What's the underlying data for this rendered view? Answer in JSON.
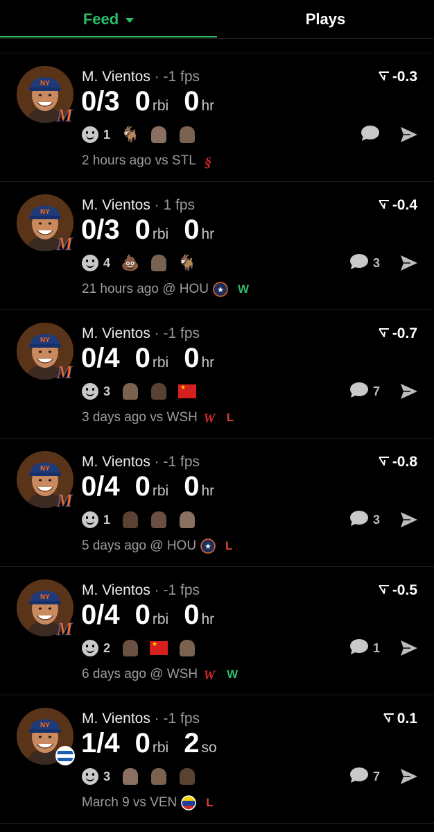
{
  "tabs": [
    {
      "label": "Feed",
      "active": true
    },
    {
      "label": "Plays",
      "active": false
    }
  ],
  "colors": {
    "accent": "#2dbc6a",
    "win": "#2dbc6a",
    "loss": "#e0403a",
    "background": "#000000"
  },
  "feed": [
    {
      "player": "M. Vientos",
      "fps": "-1 fps",
      "score_icon": "volatility-icon",
      "score": "-0.3",
      "hits": "0/3",
      "stat2_value": "0",
      "stat2_unit": "rbi",
      "stat3_value": "0",
      "stat3_unit": "hr",
      "smile_count": "1",
      "reactions": [
        "goat-emoji",
        "face-emoji",
        "face-emoji"
      ],
      "comment_count": "",
      "time": "2 hours ago",
      "venue": "vs STL",
      "opponent_icon": "cardinals-logo-icon",
      "result": "",
      "badge": "mets-logo-icon"
    },
    {
      "player": "M. Vientos",
      "fps": "1 fps",
      "score_icon": "volatility-icon",
      "score": "-0.4",
      "hits": "0/3",
      "stat2_value": "0",
      "stat2_unit": "rbi",
      "stat3_value": "0",
      "stat3_unit": "hr",
      "smile_count": "4",
      "reactions": [
        "poop-emoji",
        "face-emoji",
        "goat-emoji"
      ],
      "comment_count": "3",
      "time": "21 hours ago",
      "venue": "@ HOU",
      "opponent_icon": "astros-logo-icon",
      "result": "W",
      "badge": "mets-logo-icon"
    },
    {
      "player": "M. Vientos",
      "fps": "-1 fps",
      "score_icon": "volatility-icon",
      "score": "-0.7",
      "hits": "0/4",
      "stat2_value": "0",
      "stat2_unit": "rbi",
      "stat3_value": "0",
      "stat3_unit": "hr",
      "smile_count": "3",
      "reactions": [
        "face-emoji",
        "face-emoji",
        "china-flag-emoji"
      ],
      "comment_count": "7",
      "time": "3 days ago",
      "venue": "vs WSH",
      "opponent_icon": "nationals-logo-icon",
      "result": "L",
      "badge": "mets-logo-icon"
    },
    {
      "player": "M. Vientos",
      "fps": "-1 fps",
      "score_icon": "volatility-icon",
      "score": "-0.8",
      "hits": "0/4",
      "stat2_value": "0",
      "stat2_unit": "rbi",
      "stat3_value": "0",
      "stat3_unit": "hr",
      "smile_count": "1",
      "reactions": [
        "face-emoji",
        "face-emoji",
        "face-emoji"
      ],
      "comment_count": "3",
      "time": "5 days ago",
      "venue": "@ HOU",
      "opponent_icon": "astros-logo-icon",
      "result": "L",
      "badge": "mets-logo-icon"
    },
    {
      "player": "M. Vientos",
      "fps": "-1 fps",
      "score_icon": "volatility-icon",
      "score": "-0.5",
      "hits": "0/4",
      "stat2_value": "0",
      "stat2_unit": "rbi",
      "stat3_value": "0",
      "stat3_unit": "hr",
      "smile_count": "2",
      "reactions": [
        "face-emoji",
        "china-flag-emoji",
        "face-emoji"
      ],
      "comment_count": "1",
      "time": "6 days ago",
      "venue": "@ WSH",
      "opponent_icon": "nationals-logo-icon",
      "result": "W",
      "badge": "mets-logo-icon"
    },
    {
      "player": "M. Vientos",
      "fps": "-1 fps",
      "score_icon": "volatility-icon",
      "score": "0.1",
      "hits": "1/4",
      "stat2_value": "0",
      "stat2_unit": "rbi",
      "stat3_value": "2",
      "stat3_unit": "so",
      "smile_count": "3",
      "reactions": [
        "face-emoji",
        "face-emoji",
        "face-emoji"
      ],
      "comment_count": "7",
      "time": "March 9",
      "venue": "vs VEN",
      "opponent_icon": "venezuela-flag-icon",
      "result": "L",
      "badge": "nicaragua-flag-icon"
    }
  ]
}
